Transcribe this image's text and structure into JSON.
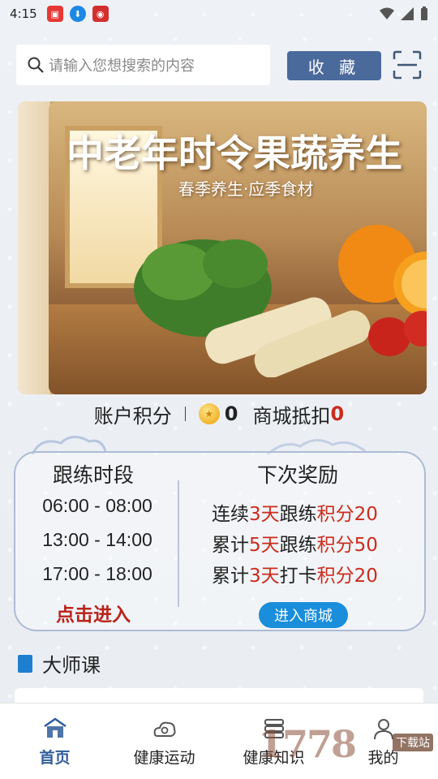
{
  "status_bar": {
    "time": "4:15"
  },
  "search": {
    "placeholder": "请输入您想搜索的内容"
  },
  "header": {
    "favorite_label": "收 藏"
  },
  "banner": {
    "title": "中老年时令果蔬养生",
    "subtitle": "春季养生·应季食材"
  },
  "points": {
    "account_label": "账户积分",
    "account_value": "0",
    "discount_label": "商城抵扣",
    "discount_value": "0"
  },
  "practice": {
    "times_title": "跟练时段",
    "times": [
      "06:00 - 08:00",
      "13:00 - 14:00",
      "17:00 - 18:00"
    ],
    "enter_label": "点击进入",
    "rewards_title": "下次奖励",
    "rewards": [
      {
        "prefix": "连续",
        "days": "3天",
        "action": "跟练",
        "points_label": "积分20"
      },
      {
        "prefix": "累计",
        "days": "5天",
        "action": "跟练",
        "points_label": "积分50"
      },
      {
        "prefix": "累计",
        "days": "3天",
        "action": "打卡",
        "points_label": "积分20"
      }
    ],
    "shop_label": "进入商城"
  },
  "course": {
    "title": "大师课"
  },
  "nav": {
    "items": [
      {
        "label": "首页",
        "icon": "home-icon",
        "active": true
      },
      {
        "label": "健康运动",
        "icon": "cloud-swirl-icon",
        "active": false
      },
      {
        "label": "健康知识",
        "icon": "book-stack-icon",
        "active": false
      },
      {
        "label": "我的",
        "icon": "profile-icon",
        "active": false
      }
    ]
  },
  "watermark": {
    "text": "1778",
    "small_text": "下载站"
  },
  "colors": {
    "accent_blue": "#4b6a9c",
    "shop_blue": "#1a8ddb",
    "highlight_red": "#cc2b1d",
    "nav_active": "#2f5c9a"
  }
}
